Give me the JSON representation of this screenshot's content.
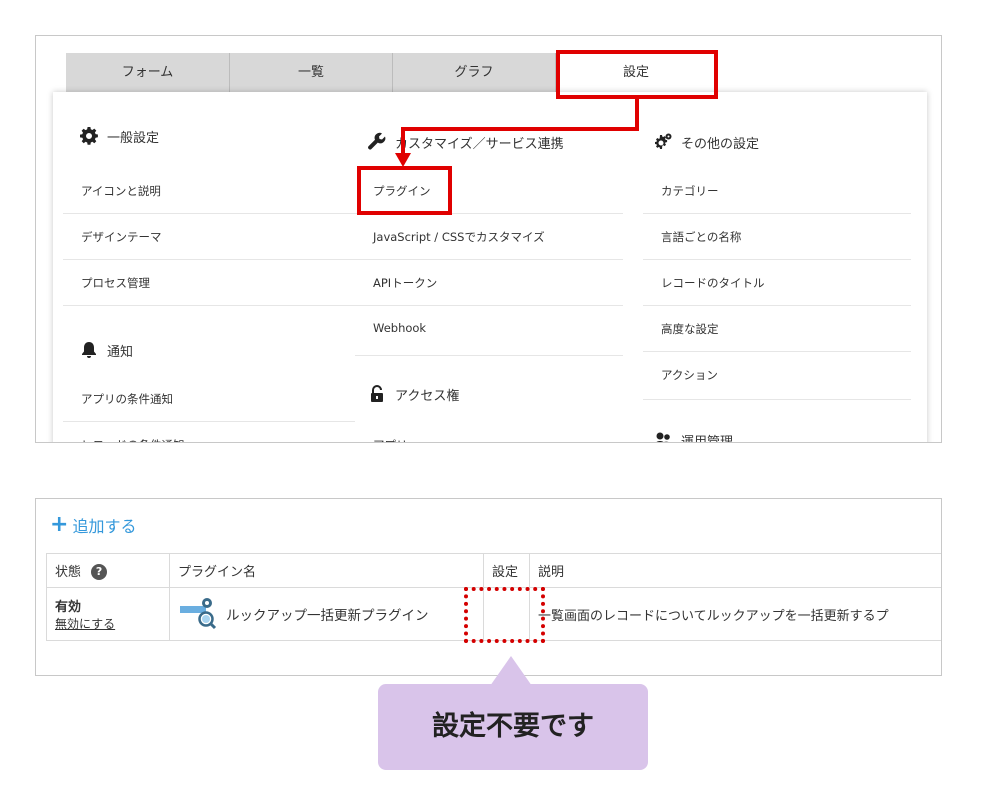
{
  "tabs": [
    "フォーム",
    "一覧",
    "グラフ",
    "設定"
  ],
  "columns": [
    {
      "sections": [
        {
          "heading": "一般設定",
          "icon": "gear-icon",
          "items": [
            "アイコンと説明",
            "デザインテーマ",
            "プロセス管理"
          ]
        },
        {
          "heading": "通知",
          "icon": "bell-icon",
          "items": [
            "アプリの条件通知",
            "レコードの条件通知"
          ]
        }
      ]
    },
    {
      "sections": [
        {
          "heading": "カスタマイズ／サービス連携",
          "icon": "wrench-icon",
          "items": [
            "プラグイン",
            "JavaScript / CSSでカスタマイズ",
            "APIトークン",
            "Webhook"
          ]
        },
        {
          "heading": "アクセス権",
          "icon": "unlock-icon",
          "items": [
            "アプリ"
          ]
        }
      ]
    },
    {
      "sections": [
        {
          "heading": "その他の設定",
          "icon": "gears-icon",
          "items": [
            "カテゴリー",
            "言語ごとの名称",
            "レコードのタイトル",
            "高度な設定",
            "アクション"
          ]
        },
        {
          "heading": "運用管理",
          "icon": "people-icon",
          "items": []
        }
      ]
    }
  ],
  "plugins": {
    "add_label": "追加する",
    "headers": {
      "status": "状態",
      "name": "プラグイン名",
      "settings": "設定",
      "description": "説明"
    },
    "rows": [
      {
        "status": "有効",
        "disable_label": "無効にする",
        "name": "ルックアップ一括更新プラグイン",
        "description": "一覧画面のレコードについてルックアップを一括更新するプ"
      }
    ]
  },
  "note": "設定不要です",
  "colors": {
    "highlight": "#e00000",
    "note_bg": "#d9c4ea",
    "link": "#3498db"
  }
}
